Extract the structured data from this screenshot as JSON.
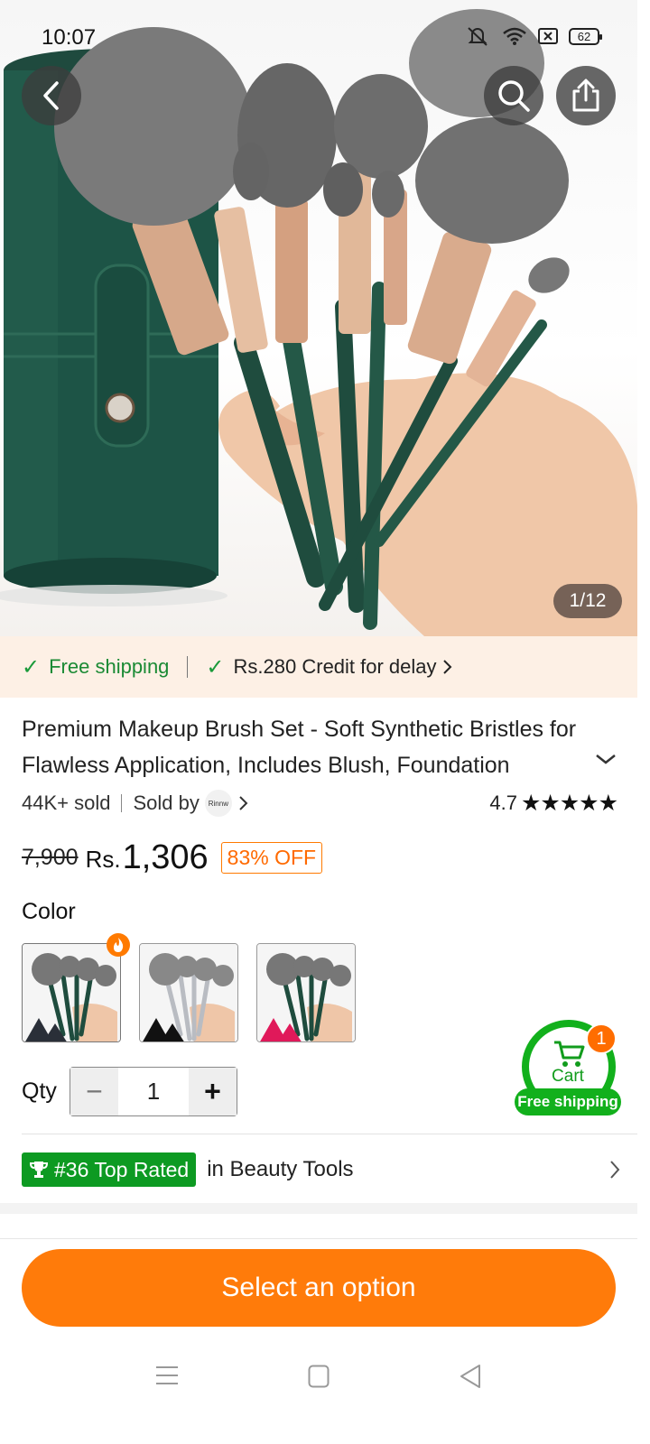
{
  "status_bar": {
    "time": "10:07",
    "battery": "62"
  },
  "hero": {
    "pager": "1/12"
  },
  "promo": {
    "free_shipping": "Free shipping",
    "credit": "Rs.280 Credit for delay"
  },
  "product": {
    "title": "Premium Makeup Brush Set - Soft Synthetic Bristles for Flawless Application, Includes Blush, Foundation",
    "sold": "44K+ sold",
    "sold_by": "Sold by",
    "seller_logo_text": "Rinnw",
    "rating": "4.7",
    "stars": "★★★★★",
    "old_price": "7,900",
    "currency": "Rs.",
    "price": "1,306",
    "discount": "83% OFF"
  },
  "options": {
    "color_label": "Color",
    "swatches": [
      {
        "name": "green",
        "puff_color": "#2a2f38"
      },
      {
        "name": "silver",
        "puff_color": "#111111"
      },
      {
        "name": "green-pink",
        "puff_color": "#e0195a"
      }
    ],
    "qty_label": "Qty",
    "qty_value": "1",
    "minus": "−",
    "plus": "+"
  },
  "cart": {
    "label": "Cart",
    "badge": "1",
    "free_shipping": "Free shipping"
  },
  "ranking": {
    "rank": "#36 Top Rated",
    "category": "in Beauty Tools"
  },
  "cta": {
    "label": "Select an option"
  },
  "colors": {
    "accent": "#ff7b0a",
    "green": "#12b01c",
    "promo_bg": "#fdf0e5"
  }
}
